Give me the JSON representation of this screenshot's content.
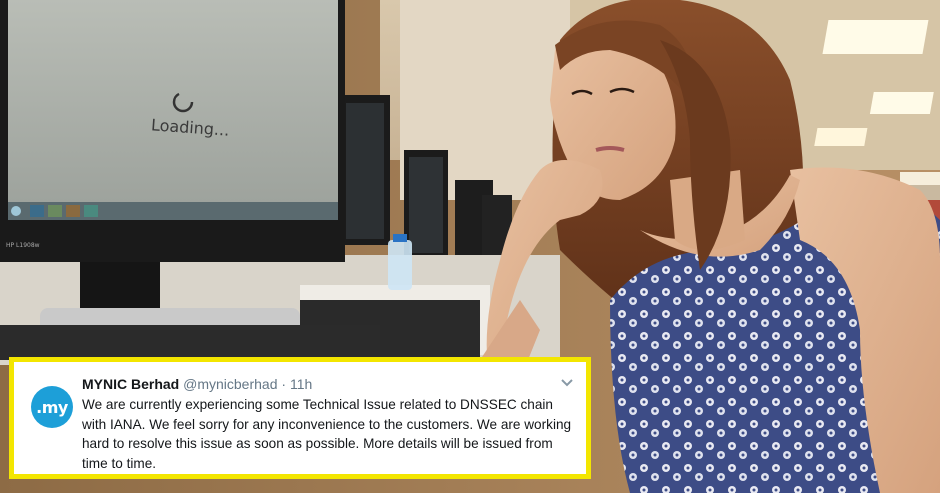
{
  "monitor": {
    "loading_text": "Loading...",
    "brand_label": "HP L1908w"
  },
  "tweet": {
    "avatar_text": ".my",
    "display_name": "MYNIC Berhad",
    "handle": "@mynicberhad",
    "separator": "·",
    "time": "11h",
    "text": "We are currently experiencing some Technical Issue related to DNSSEC chain with IANA. We feel sorry for any inconvenience to the customers. We are working hard to resolve this issue as soon as possible. More details will be issued from time to time.",
    "border_color": "#f3e600",
    "avatar_color": "#1d9fd8"
  }
}
